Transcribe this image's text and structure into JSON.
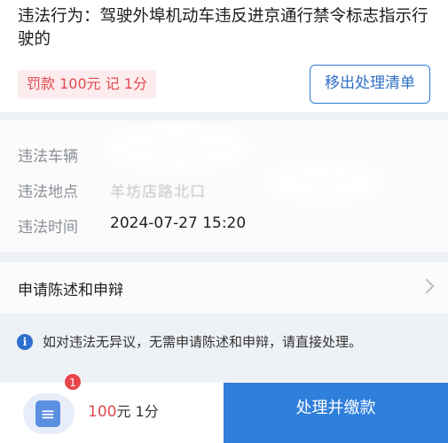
{
  "violation": {
    "title": "违法行为：驾驶外埠机动车违反进京通行禁令标志指示行驶的",
    "fine_tag": "罚款 100元  记 1分",
    "remove_button": "移出处理清单"
  },
  "details": [
    {
      "label": "违法车辆",
      "value": ""
    },
    {
      "label": "违法地点",
      "value": "羊坊店路北口"
    },
    {
      "label": "违法时间",
      "value": "2024-07-27 15:20"
    }
  ],
  "appeal": {
    "label": "申请陈述和申辩"
  },
  "notice": {
    "text": "如对违法无异议，无需申请陈述和申辩，请直接处理。"
  },
  "bottom_bar": {
    "badge_count": "1",
    "amount": "100",
    "unit_text": "元 1分",
    "pay_button": "处理并缴款"
  },
  "colors": {
    "accent": "#2f7fdc",
    "fine_red": "#e04a4f",
    "badge_red": "#e8464c"
  }
}
